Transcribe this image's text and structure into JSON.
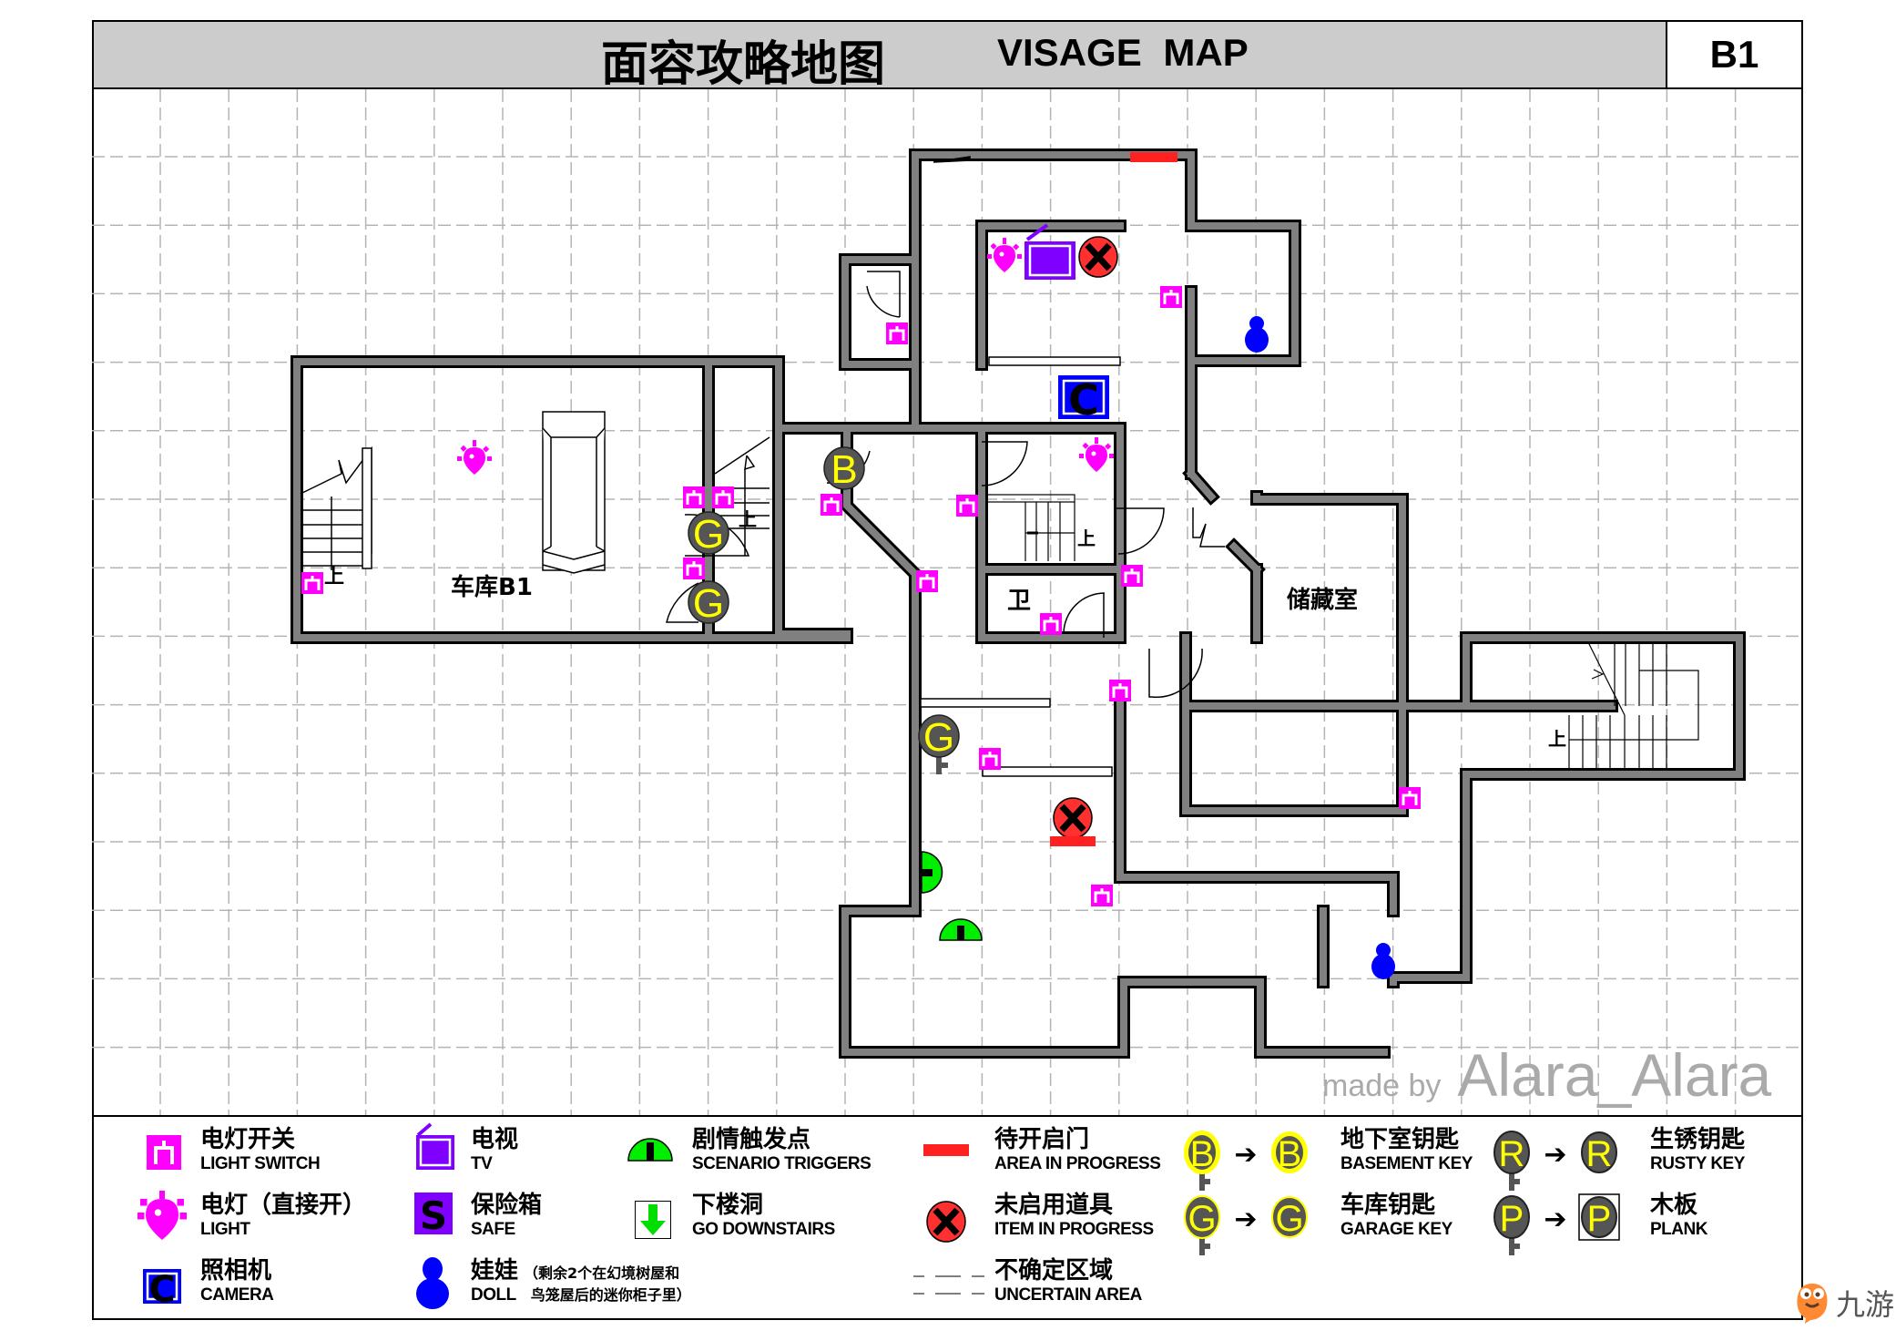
{
  "header": {
    "title_cn": "面容攻略地图",
    "title_en": "VISAGE  MAP",
    "floor": "B1"
  },
  "colors": {
    "wall_fill": "#808080",
    "wall_outline": "#000000",
    "grid": "#b4b4b4",
    "header_bg": "#cccccc",
    "light_switch": "#ff00ff",
    "light": "#ff00ff",
    "tv": "#7f00ff",
    "camera": "#0000ff",
    "safe": "#7f00ff",
    "doll": "#0000ff",
    "scenario_trigger": "#00ee00",
    "go_downstairs": "#00dd00",
    "area_in_progress": "#ff2020",
    "item_in_progress": "#ff3030",
    "key_body": "#555555",
    "key_letter": "#ffff00",
    "watermark": "#aaaaaa"
  },
  "map": {
    "rooms": [
      {
        "name": "garage",
        "label": "车库B1"
      },
      {
        "name": "bathroom",
        "label": "卫"
      },
      {
        "name": "storage",
        "label": "储藏室"
      }
    ],
    "stair_labels": [
      "上",
      "上",
      "上",
      "上"
    ],
    "markers": {
      "light_switch_count": 16,
      "lights": 3,
      "tv": 1,
      "camera": 1,
      "dolls": 2,
      "items_in_progress": 2,
      "scenario_triggers": 2,
      "area_in_progress_doors": 1,
      "keys": [
        {
          "type": "B",
          "name": "basement-key-door"
        },
        {
          "type": "G",
          "name": "garage-key-door"
        },
        {
          "type": "G",
          "name": "garage-key-door"
        },
        {
          "type": "G",
          "name": "garage-key-item"
        }
      ]
    }
  },
  "watermark": {
    "prefix": "made by",
    "author": "Alara_Alara"
  },
  "legend": {
    "items": [
      {
        "id": "light-switch",
        "cn": "电灯开关",
        "en": "LIGHT SWITCH"
      },
      {
        "id": "light",
        "cn": "电灯（直接开）",
        "en": "LIGHT"
      },
      {
        "id": "camera",
        "cn": "照相机",
        "en": "CAMERA"
      },
      {
        "id": "tv",
        "cn": "电视",
        "en": "TV"
      },
      {
        "id": "safe",
        "cn": "保险箱",
        "en": "SAFE",
        "icon_letter": "S"
      },
      {
        "id": "doll",
        "cn": "娃娃",
        "en": "DOLL",
        "note_line1": "（剩余2个在幻境树屋和",
        "note_line2": "鸟笼屋后的迷你柜子里）"
      },
      {
        "id": "scenario-triggers",
        "cn": "剧情触发点",
        "en": "SCENARIO TRIGGERS"
      },
      {
        "id": "go-downstairs",
        "cn": "下楼洞",
        "en": "GO DOWNSTAIRS"
      },
      {
        "id": "area-in-progress",
        "cn": "待开启门",
        "en": "AREA IN PROGRESS"
      },
      {
        "id": "item-in-progress",
        "cn": "未启用道具",
        "en": "ITEM IN PROGRESS"
      },
      {
        "id": "uncertain-area",
        "cn": "不确定区域",
        "en": "UNCERTAIN AREA"
      },
      {
        "id": "basement-key",
        "cn": "地下室钥匙",
        "en": "BASEMENT KEY",
        "letter": "B"
      },
      {
        "id": "garage-key",
        "cn": "车库钥匙",
        "en": "GARAGE KEY",
        "letter": "G"
      },
      {
        "id": "rusty-key",
        "cn": "生锈钥匙",
        "en": "RUSTY KEY",
        "letter": "R"
      },
      {
        "id": "plank",
        "cn": "木板",
        "en": "PLANK",
        "letter": "P"
      }
    ],
    "camera_letter": "C",
    "arrow": "➔"
  },
  "logo": {
    "text": "九游"
  }
}
